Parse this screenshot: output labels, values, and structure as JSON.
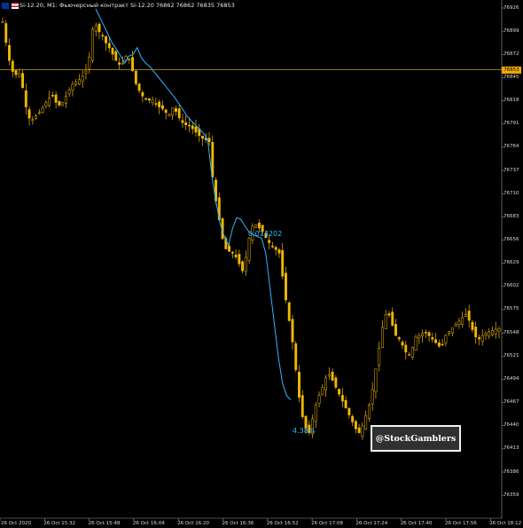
{
  "window": {
    "title": "Si-12.20, M1: Фьючерсный контракт Si-12.20  76862 76862 76835 76853",
    "icons": [
      "eu-flag-icon",
      "us-flag-icon"
    ]
  },
  "current_price_label": "76853",
  "annotations": {
    "upper": "0.014202",
    "lower": "4.38%"
  },
  "watermark": "@StockGamblers",
  "colors": {
    "background": "#000000",
    "candle": "#f0b800",
    "moving_average": "#32b4ff",
    "price_line": "#c89600",
    "axis_text": "#d8d8d8"
  },
  "chart_data": {
    "type": "candlestick",
    "symbol": "Si-12.20",
    "timeframe": "M1",
    "y_ticks": [
      "76926",
      "76899",
      "76872",
      "76845",
      "76818",
      "76791",
      "76764",
      "76737",
      "76710",
      "76683",
      "76656",
      "76629",
      "76602",
      "76575",
      "76548",
      "76521",
      "76494",
      "76467",
      "76440",
      "76413",
      "76386",
      "76359"
    ],
    "x_ticks": [
      "26 Oct 2020",
      "26 Oct 15:32",
      "26 Oct 15:48",
      "26 Oct 16:04",
      "26 Oct 16:20",
      "26 Oct 16:36",
      "26 Oct 16:52",
      "26 Oct 17:08",
      "26 Oct 17:24",
      "26 Oct 17:40",
      "26 Oct 17:56",
      "26 Oct 18:12"
    ],
    "ylim": [
      76350,
      76930
    ],
    "last_price": 76853,
    "close_series": [
      76910,
      76880,
      76855,
      76848,
      76850,
      76830,
      76800,
      76795,
      76800,
      76805,
      76812,
      76820,
      76825,
      76815,
      76812,
      76820,
      76830,
      76838,
      76840,
      76845,
      76850,
      76870,
      76912,
      76900,
      76895,
      76885,
      76878,
      76868,
      76860,
      76862,
      76872,
      76862,
      76840,
      76830,
      76822,
      76818,
      76820,
      76815,
      76810,
      76808,
      76800,
      76810,
      76805,
      76795,
      76790,
      76790,
      76785,
      76780,
      76775,
      76773,
      76770,
      76715,
      76690,
      76660,
      76645,
      76642,
      76640,
      76630,
      76620,
      76640,
      76670,
      76675,
      76670,
      76665,
      76655,
      76650,
      76645,
      76640,
      76600,
      76570,
      76540,
      76500,
      76460,
      76440,
      76430,
      76450,
      76470,
      76480,
      76495,
      76500,
      76490,
      76480,
      76470,
      76460,
      76450,
      76440,
      76430,
      76440,
      76455,
      76470,
      76500,
      76530,
      76560,
      76575,
      76560,
      76545,
      76540,
      76530,
      76520,
      76530,
      76545,
      76545,
      76550,
      76545,
      76540,
      76535,
      76530,
      76545,
      76550,
      76555,
      76560,
      76565,
      76570,
      76560,
      76545,
      76540,
      76545,
      76548,
      76550,
      76552,
      76553
    ],
    "moving_average": [
      76925,
      76915,
      76905,
      76895,
      76885,
      76878,
      76870,
      76862,
      76870,
      76872,
      76880,
      76868,
      76862,
      76858,
      76852,
      76846,
      76840,
      76834,
      76828,
      76822,
      76815,
      76808,
      76800,
      76795,
      76790,
      76785,
      76780,
      76772,
      76730,
      76700,
      76675,
      76660,
      76650,
      76670,
      76682,
      76680,
      76672,
      76665,
      76662,
      76660,
      76658,
      76640,
      76600,
      76560,
      76520,
      76490,
      76475,
      76470
    ]
  }
}
